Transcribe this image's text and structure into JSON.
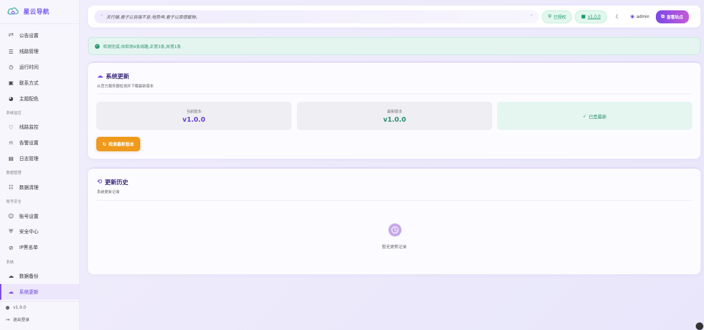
{
  "brand": {
    "name": "星云导航"
  },
  "sidebar": {
    "groups": [
      {
        "section": "",
        "items": [
          {
            "label": "公告设置",
            "icon": "megaphone-icon"
          },
          {
            "label": "线路管理",
            "icon": "list-icon"
          },
          {
            "label": "运行时间",
            "icon": "clock-icon"
          },
          {
            "label": "联系方式",
            "icon": "contact-card-icon"
          },
          {
            "label": "主题配色",
            "icon": "palette-icon"
          }
        ]
      },
      {
        "section": "系统监控",
        "items": [
          {
            "label": "线路监控",
            "icon": "heartbeat-icon"
          },
          {
            "label": "告警设置",
            "icon": "bell-icon"
          },
          {
            "label": "日志管理",
            "icon": "log-icon"
          }
        ]
      },
      {
        "section": "数据管理",
        "items": [
          {
            "label": "数据清理",
            "icon": "database-icon"
          }
        ]
      },
      {
        "section": "账号安全",
        "items": [
          {
            "label": "账号设置",
            "icon": "user-gear-icon"
          },
          {
            "label": "安全中心",
            "icon": "shield-icon"
          },
          {
            "label": "IP黑名单",
            "icon": "ban-icon"
          }
        ]
      },
      {
        "section": "系统",
        "items": [
          {
            "label": "数据备份",
            "icon": "cloud-upload-icon"
          },
          {
            "label": "系统更新",
            "icon": "cloud-icon",
            "active": true
          }
        ]
      }
    ],
    "version": "v1.0.0",
    "logout": "退出登录"
  },
  "topbar": {
    "quote": "天行健,君子以自强不息;地势坤,君子以厚德载物。",
    "authorized": "已授权",
    "version": "v1.0.0",
    "user": "admin",
    "view_site": "查看站点"
  },
  "alert": {
    "text": "检测完成:共检测4条线路,正常3条,异常1条"
  },
  "update_card": {
    "title": "系统更新",
    "subtitle": "从官方服务器检测并下载最新版本",
    "current_label": "当前版本",
    "current_value": "v1.0.0",
    "latest_label": "最新版本",
    "latest_value": "v1.0.0",
    "status": "已是最新",
    "check_button": "检测最新版本"
  },
  "history_card": {
    "title": "更新历史",
    "subtitle": "系统更新记录",
    "empty": "暂无更新记录"
  },
  "colors": {
    "accent": "#7a48e6",
    "success": "#2b8f6b",
    "warning": "#ef9a1c",
    "current_version": "#6a3fd0"
  }
}
